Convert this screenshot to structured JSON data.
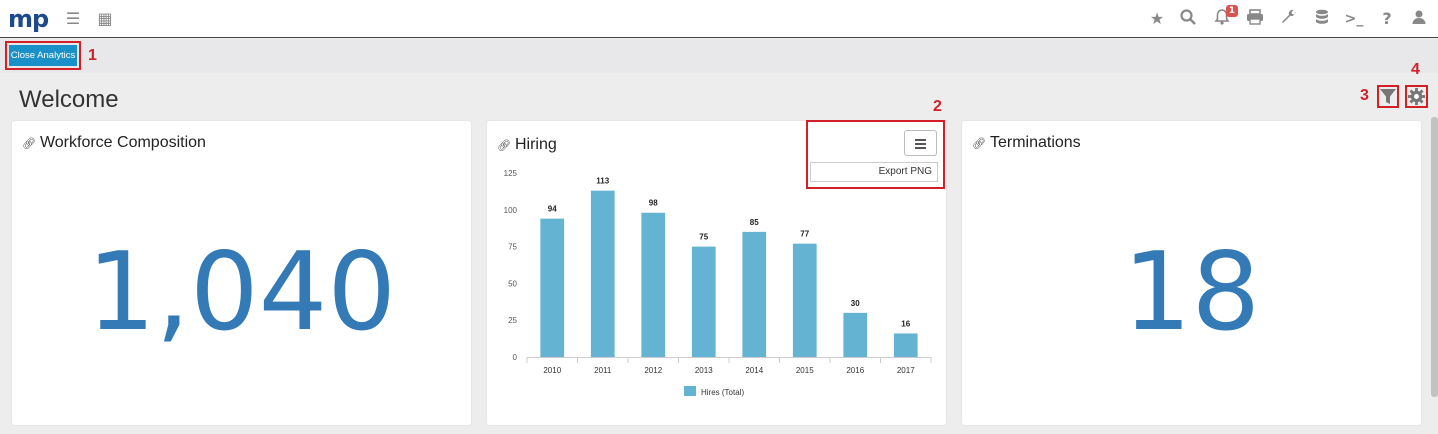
{
  "app": {
    "logo": "mp"
  },
  "topbar": {
    "icons": [
      "star-icon",
      "search-icon",
      "bell-icon",
      "print-icon",
      "wrench-icon",
      "database-icon",
      "terminal-icon",
      "help-icon",
      "user-icon"
    ],
    "notification_count": "1"
  },
  "toolbar": {
    "close_analytics_label": "Close Analytics"
  },
  "annotations": [
    "1",
    "2",
    "3",
    "4"
  ],
  "page": {
    "title": "Welcome"
  },
  "cards": {
    "workforce": {
      "title": "Workforce Composition",
      "value": "1,040"
    },
    "hiring": {
      "title": "Hiring",
      "export_label": "Export PNG"
    },
    "terminations": {
      "title": "Terminations",
      "value": "18"
    }
  },
  "chart_data": {
    "type": "bar",
    "title": "Hiring",
    "categories": [
      "2010",
      "2011",
      "2012",
      "2013",
      "2014",
      "2015",
      "2016",
      "2017"
    ],
    "series": [
      {
        "name": "Hires (Total)",
        "values": [
          94,
          113,
          98,
          75,
          85,
          77,
          30,
          16
        ]
      }
    ],
    "ylim": [
      0,
      125
    ],
    "yticks": [
      0,
      25,
      50,
      75,
      100,
      125
    ],
    "data_labels": true,
    "legend": "bottom",
    "color": "#65b3d3"
  }
}
